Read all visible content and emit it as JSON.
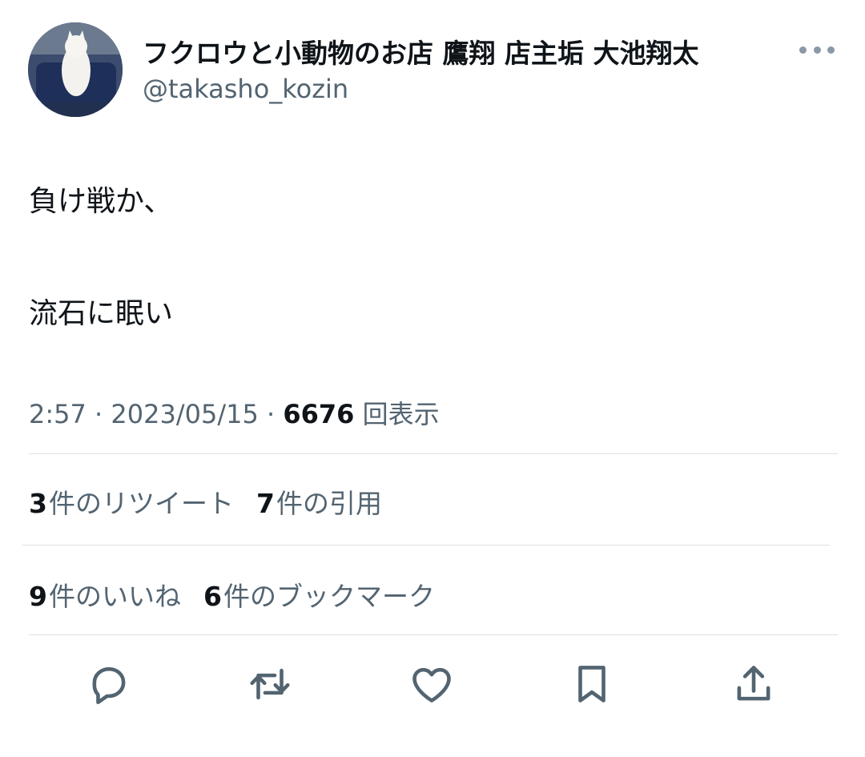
{
  "tweet": {
    "author": {
      "display_name": "フクロウと小動物のお店 鷹翔 店主垢 大池翔太",
      "handle": "@takasho_kozin"
    },
    "text_line1": "負け戦か、",
    "text_line2": "流石に眠い",
    "meta": {
      "time": "2:57",
      "separator": "·",
      "date": "2023/05/15",
      "views": "6676",
      "views_label": "回表示"
    },
    "stats": {
      "retweets": "3",
      "retweets_label": "件のリツイート",
      "quotes": "7",
      "quotes_label": "件の引用",
      "likes": "9",
      "likes_label": "件のいいね",
      "bookmarks": "6",
      "bookmarks_label": "件のブックマーク"
    },
    "actions": [
      "reply-icon",
      "retweet-icon",
      "like-icon",
      "bookmark-icon",
      "share-icon"
    ],
    "colors": {
      "text": "#0f1419",
      "secondary": "#536471",
      "divider": "#dcdfe3"
    }
  }
}
